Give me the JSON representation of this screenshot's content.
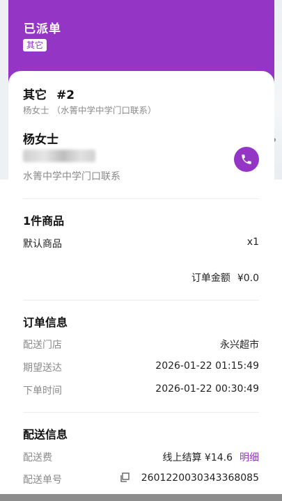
{
  "header": {
    "title": "已派单",
    "tag": "其它"
  },
  "order": {
    "type": "其它",
    "number": "#2",
    "customer_subtitle": "杨女士 （水箐中学中学门口联系）",
    "customer_name": "杨女士",
    "address": "水箐中学中学门口联系"
  },
  "goods": {
    "title": "1件商品",
    "items": [
      {
        "name": "默认商品",
        "qty": "x1"
      }
    ],
    "amount_label": "订单金额",
    "amount_value": "¥0.0"
  },
  "order_info": {
    "title": "订单信息",
    "rows": [
      {
        "label": "配送门店",
        "value": "永兴超市"
      },
      {
        "label": "期望送达",
        "value": "2026-01-22 01:15:49"
      },
      {
        "label": "下单时间",
        "value": "2026-01-22 00:30:49"
      }
    ]
  },
  "delivery_info": {
    "title": "配送信息",
    "fee_label": "配送费",
    "fee_value": "线上结算 ¥14.6",
    "fee_link": "明细",
    "tracking_label": "配送单号",
    "tracking_value": "2601220030343368085"
  },
  "colors": {
    "accent": "#9535c6"
  },
  "icons": {
    "call": "phone-icon",
    "copy": "copy-icon",
    "map_poi": "person-poi-icon"
  }
}
